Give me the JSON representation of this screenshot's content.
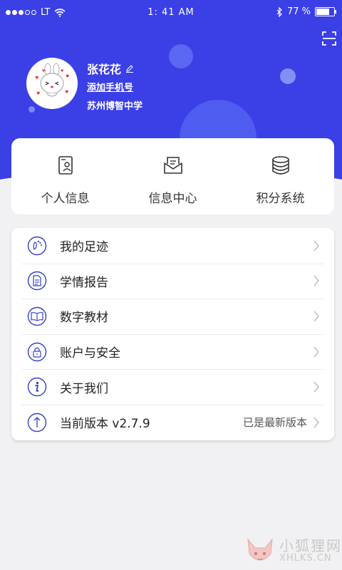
{
  "status_bar": {
    "carrier": "LT",
    "time": "1: 41 AM",
    "battery_percent": "77 %",
    "battery_level": 0.77
  },
  "profile": {
    "name": "张花花",
    "add_phone_link": "添加手机号",
    "school": "苏州博智中学"
  },
  "quick_menu": [
    {
      "label": "个人信息",
      "icon": "profile-card-icon"
    },
    {
      "label": "信息中心",
      "icon": "envelope-icon"
    },
    {
      "label": "积分系统",
      "icon": "coin-stack-icon"
    }
  ],
  "menu": [
    {
      "label": "我的足迹",
      "icon": "footprint-icon"
    },
    {
      "label": "学情报告",
      "icon": "report-document-icon"
    },
    {
      "label": "数字教材",
      "icon": "open-book-icon"
    },
    {
      "label": "账户与安全",
      "icon": "lock-icon"
    },
    {
      "label": "关于我们",
      "icon": "info-icon"
    },
    {
      "label": "当前版本 v2.7.9",
      "icon": "upload-arrow-icon",
      "extra": "已是最新版本"
    }
  ],
  "watermark": {
    "title": "小狐狸网",
    "domain": "XHLKS.CN"
  },
  "colors": {
    "header_blue": "#3a3fe6",
    "icon_blue": "#3340c8",
    "background": "#f1f1f3"
  }
}
